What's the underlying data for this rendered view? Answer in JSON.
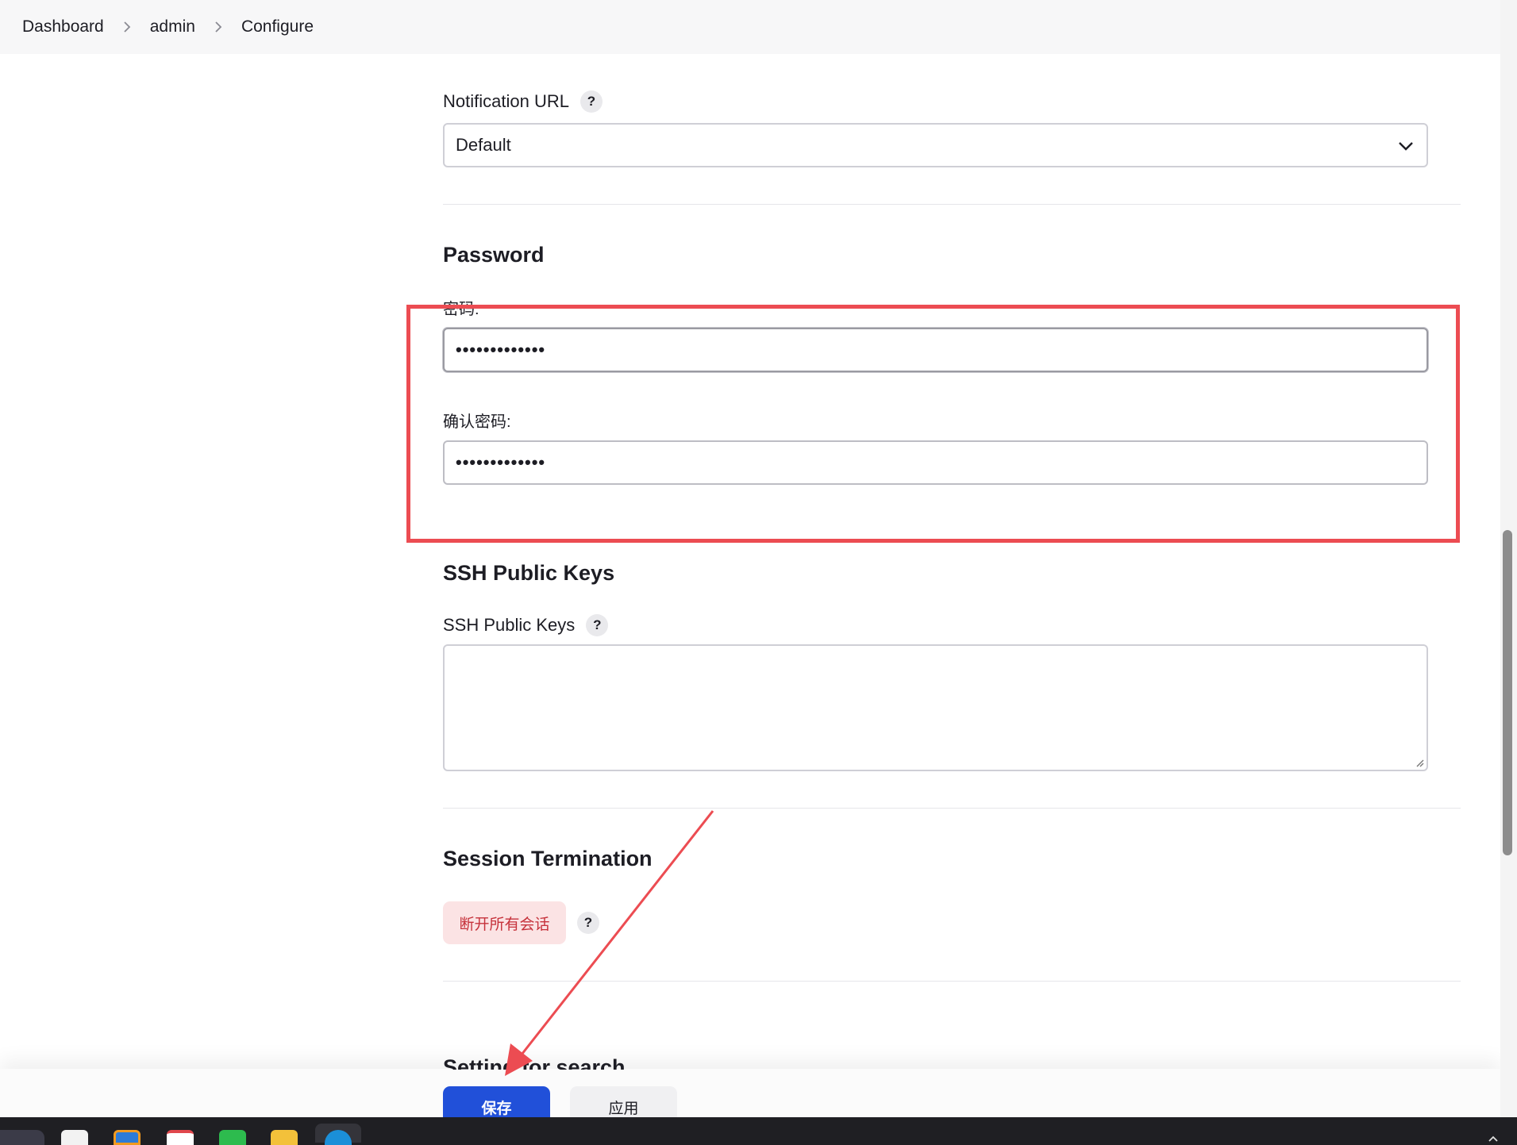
{
  "breadcrumb": [
    "Dashboard",
    "admin",
    "Configure"
  ],
  "notification": {
    "label": "Notification URL",
    "help": "?",
    "value": "Default"
  },
  "password": {
    "title": "Password",
    "password_label": "密码:",
    "password_value": "•••••••••••••",
    "confirm_label": "确认密码:",
    "confirm_value": "•••••••••••••"
  },
  "ssh": {
    "title": "SSH Public Keys",
    "label": "SSH Public Keys",
    "help": "?"
  },
  "session": {
    "title": "Session Termination",
    "button": "断开所有会话",
    "help": "?"
  },
  "next_section_title": "Setting for search",
  "actions": {
    "save": "保存",
    "apply": "应用"
  },
  "colors": {
    "highlight": "#ec4c52",
    "primary": "#2150d9",
    "danger_text": "#c6323b",
    "danger_bg": "#fbe3e4"
  },
  "taskbar_icons": [
    "search-app-icon",
    "typora-icon",
    "app-icon",
    "office-icon",
    "wechat-icon",
    "file-explorer-icon",
    "edge-icon"
  ]
}
